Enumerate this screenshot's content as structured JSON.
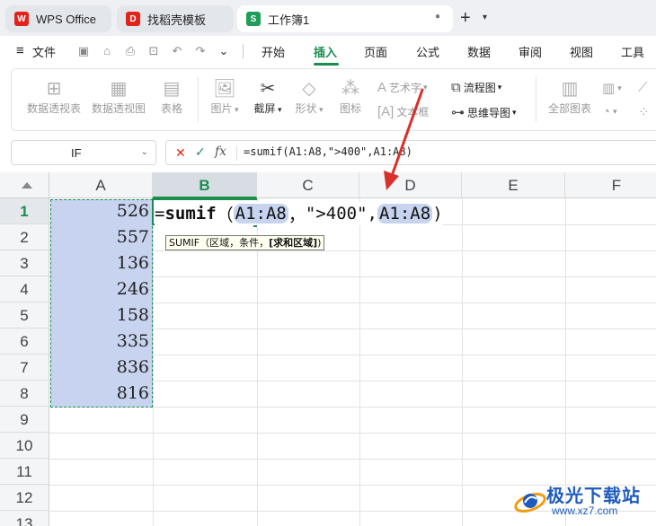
{
  "tabs": [
    {
      "label": "WPS Office",
      "icon": "wps-logo-icon"
    },
    {
      "label": "找稻壳模板",
      "icon": "docer-icon"
    },
    {
      "label": "工作簿1",
      "icon": "spreadsheet-s-icon"
    }
  ],
  "tab_icon_letters": {
    "wps": "W",
    "docer": "D",
    "sheet": "S"
  },
  "file_menu": "文件",
  "menus": [
    "开始",
    "插入",
    "页面",
    "公式",
    "数据",
    "审阅",
    "视图",
    "工具"
  ],
  "active_menu": "插入",
  "ribbon": {
    "pivot_table": "数据透视表",
    "pivot_chart": "数据透视图",
    "table": "表格",
    "picture": "图片",
    "screenshot": "截屏",
    "shape": "形状",
    "icon": "图标",
    "art_text": "艺术字",
    "text_box": "文本框",
    "flowchart": "流程图",
    "mindmap": "思维导图",
    "all_charts": "全部图表"
  },
  "formula_bar": {
    "name_box": "IF",
    "formula": "=sumif(A1:A8,\">400\",A1:A8)"
  },
  "columns": [
    "A",
    "B",
    "C",
    "D",
    "E",
    "F"
  ],
  "active_column": "B",
  "rows": [
    "1",
    "2",
    "3",
    "4",
    "5",
    "6",
    "7",
    "8",
    "9",
    "10",
    "11",
    "12",
    "13"
  ],
  "column_a_values": [
    "526",
    "557",
    "136",
    "246",
    "158",
    "335",
    "836",
    "816"
  ],
  "cell_formula": {
    "prefix": "=",
    "func": "sumif",
    "open": "（",
    "ref1": "A1:A8",
    "comma1": "，",
    "criteria": "\">400\"",
    "comma2": ",",
    "ref2": "A1:A8",
    "close": ")"
  },
  "tooltip": {
    "text": "SUMIF（区域，条件，",
    "optional": "[求和区域]",
    "close": ")"
  },
  "watermark": {
    "brand": "极光下载站",
    "url": "www.xz7.com"
  },
  "colors": {
    "accent_green": "#1b8e4e",
    "selection_blue": "#c7d3ef",
    "arrow_red": "#d9302a",
    "wps_red": "#e2231a"
  }
}
